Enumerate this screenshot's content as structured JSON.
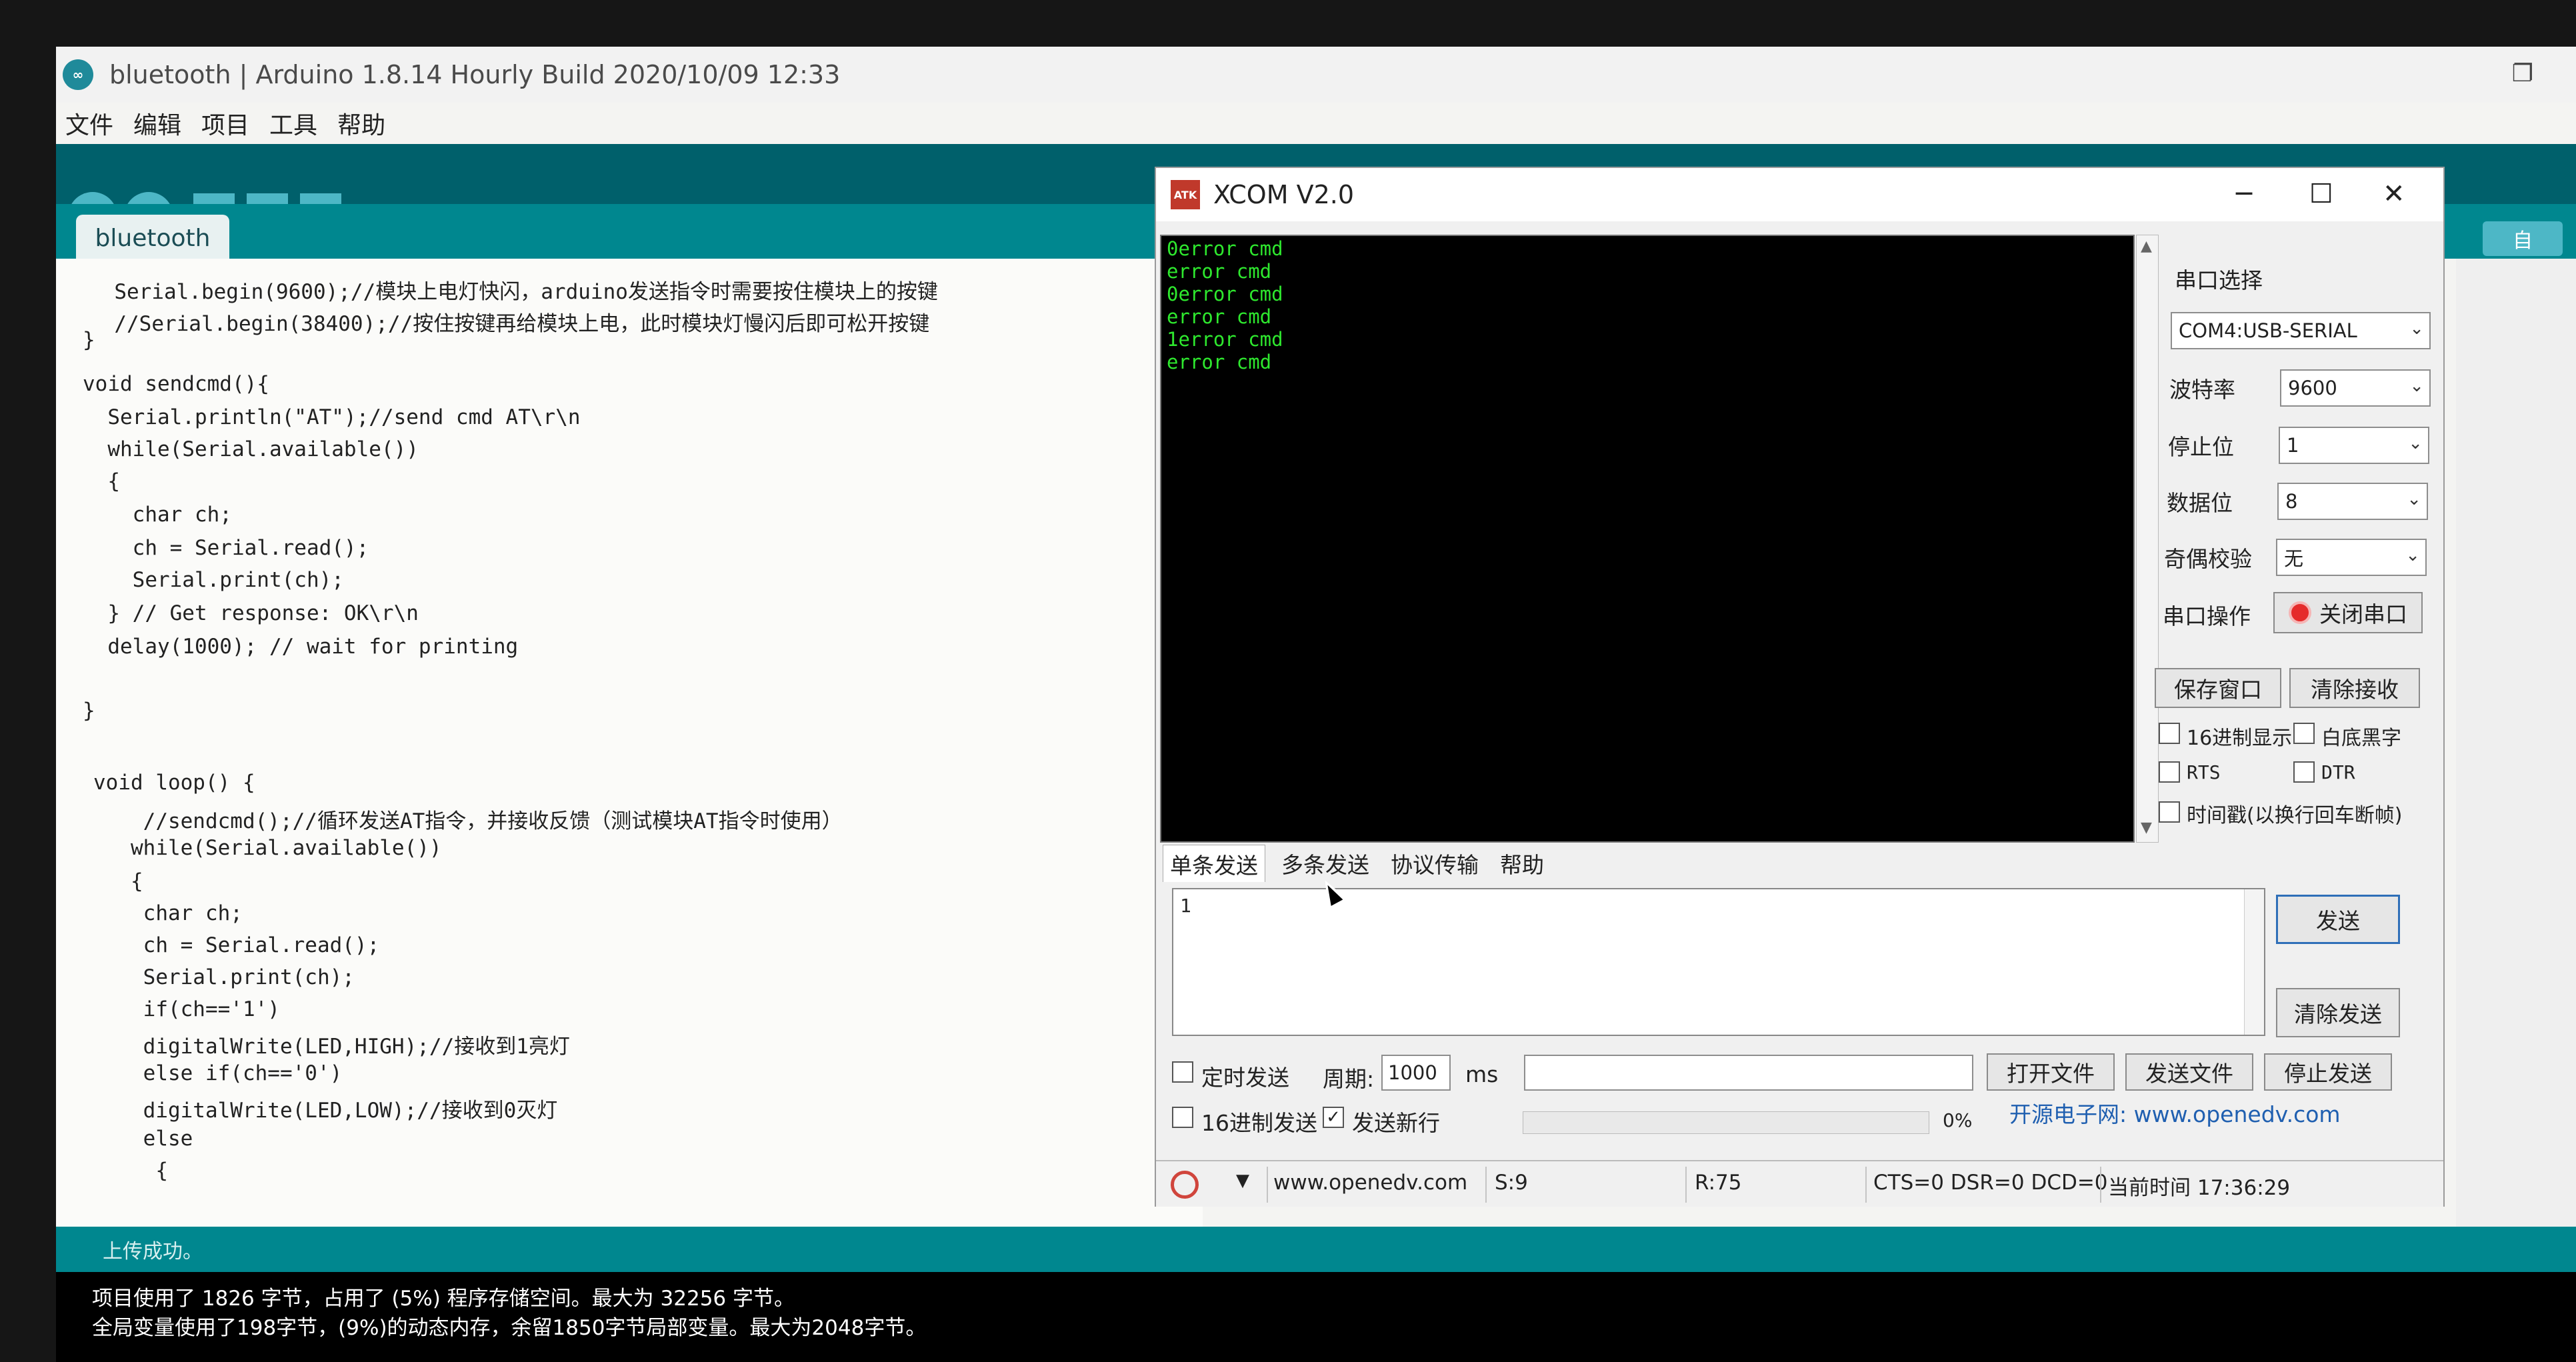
{
  "arduino": {
    "window_title": "bluetooth | Arduino 1.8.14 Hourly Build 2020/10/09 12:33",
    "menu": [
      "文件",
      "编辑",
      "项目",
      "工具",
      "帮助"
    ],
    "tab_label": "bluetooth",
    "share_label": "自",
    "code_lines": [
      "  Serial.begin(9600);//模块上电灯快闪，arduino发送指令时需要按住模块上的按键",
      "  //Serial.begin(38400);//按住按键再给模块上电，此时模块灯慢闪后即可松开按键",
      "}",
      "",
      "void sendcmd(){",
      "  Serial.println(\"AT\");//send cmd AT\\r\\n",
      "  while(Serial.available())",
      "  {",
      "    char ch;",
      "    ch = Serial.read();",
      "    Serial.print(ch);",
      "  } // Get response: OK\\r\\n",
      "  delay(1000); // wait for printing",
      "",
      "}",
      "",
      "void loop() {",
      "    //sendcmd();//循环发送AT指令，并接收反馈（测试模块AT指令时使用）",
      "   while(Serial.available())",
      "   {",
      "    char ch;",
      "    ch = Serial.read();",
      "    Serial.print(ch);",
      "    if(ch=='1')",
      "    digitalWrite(LED,HIGH);//接收到1亮灯",
      "    else if(ch=='0')",
      "    digitalWrite(LED,LOW);//接收到0灭灯",
      "    else",
      "     {"
    ],
    "status_message": "上传成功。",
    "console_lines": [
      "项目使用了 1826 字节，占用了 (5%) 程序存储空间。最大为 32256 字节。",
      "全局变量使用了198字节，(9%)的动态内存，余留1850字节局部变量。最大为2048字节。"
    ]
  },
  "xcom": {
    "window_title": "XCOM V2.0",
    "logo_text": "ATK",
    "receive_lines": [
      "0error cmd",
      "error cmd",
      "0error cmd",
      "error cmd",
      "1error cmd",
      "error cmd"
    ],
    "settings": {
      "port_label": "串口选择",
      "port_value": "COM4:USB-SERIAL",
      "baud_label": "波特率",
      "baud_value": "9600",
      "stop_label": "停止位",
      "stop_value": "1",
      "data_label": "数据位",
      "data_value": "8",
      "parity_label": "奇偶校验",
      "parity_value": "无",
      "op_label": "串口操作",
      "close_port_button": "关闭串口",
      "save_window_button": "保存窗口",
      "clear_receive_button": "清除接收",
      "hex_display_label": "16进制显示",
      "white_bg_label": "白底黑字",
      "rts_label": "RTS",
      "dtr_label": "DTR",
      "timestamp_label": "时间戳(以换行回车断帧)"
    },
    "tabs": [
      "单条发送",
      "多条发送",
      "协议传输",
      "帮助"
    ],
    "send_value": "1",
    "send_button": "发送",
    "clear_send_button": "清除发送",
    "timed_send_label": "定时发送",
    "period_label": "周期:",
    "period_value": "1000",
    "period_unit": "ms",
    "open_file_button": "打开文件",
    "send_file_button": "发送文件",
    "stop_send_button": "停止发送",
    "hex_send_label": "16进制发送",
    "send_newline_label": "发送新行",
    "progress_text": "0%",
    "progress": 0,
    "site_link": "开源电子网: www.openedv.com",
    "status": {
      "url": "www.openedv.com",
      "sent": "S:9",
      "received": "R:75",
      "lines": "CTS=0 DSR=0 DCD=0",
      "time": "当前时间 17:36:29"
    },
    "colors": {
      "receive_text": "#2ee82e",
      "receive_bg": "#000000"
    }
  }
}
